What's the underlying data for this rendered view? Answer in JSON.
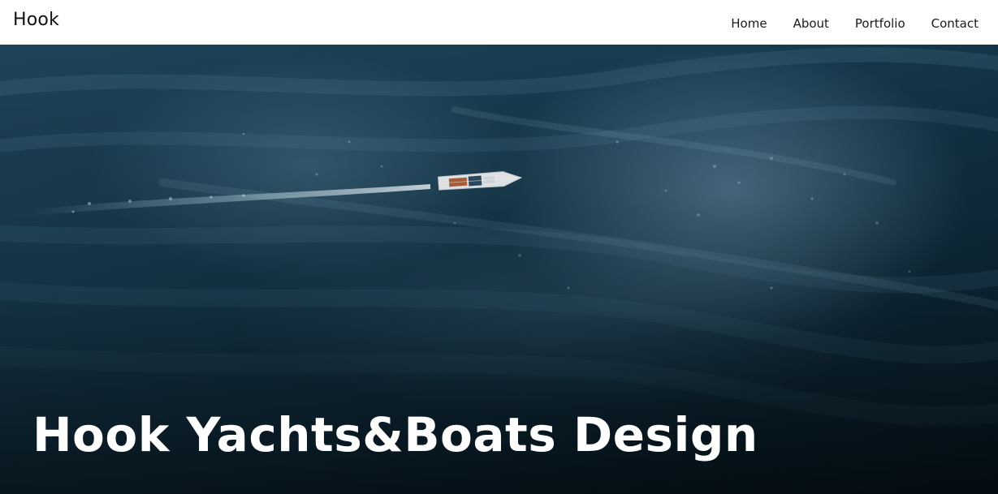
{
  "navbar": {
    "brand": "Hook",
    "links": [
      {
        "label": "Home"
      },
      {
        "label": "About"
      },
      {
        "label": "Portfolio"
      },
      {
        "label": "Contact"
      }
    ]
  },
  "hero": {
    "title": "Hook Yachts&Boats Design",
    "image": "aerial-ocean-with-sailboat"
  },
  "colors": {
    "navbar_bg": "#ffffff",
    "nav_text": "#1a1a1a",
    "ocean_dark": "#0f2c3d",
    "ocean_light": "#4e7a93",
    "hero_title": "#ffffff"
  }
}
